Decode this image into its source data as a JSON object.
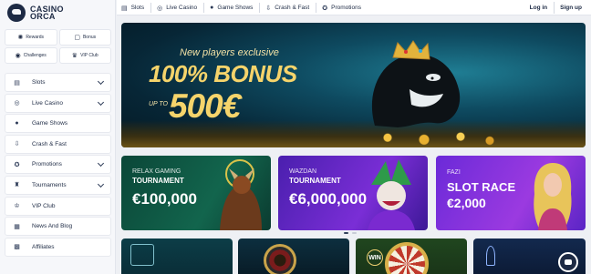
{
  "logo": {
    "line1": "CASINO",
    "line2": "ORCA"
  },
  "quick_links": [
    {
      "label": "Rewards",
      "icon": "rewards-icon",
      "glyph": "✺"
    },
    {
      "label": "Bonus",
      "icon": "bonus-icon",
      "glyph": "▢"
    },
    {
      "label": "Challenges",
      "icon": "challenges-icon",
      "glyph": "◉"
    },
    {
      "label": "VIP Club",
      "icon": "vip-club-icon",
      "glyph": "♛"
    }
  ],
  "sidebar": {
    "items": [
      {
        "label": "Slots",
        "icon": "slots-icon",
        "glyph": "▤",
        "expandable": true
      },
      {
        "label": "Live Casino",
        "icon": "live-casino-icon",
        "glyph": "◎",
        "expandable": true
      },
      {
        "label": "Game Shows",
        "icon": "game-shows-icon",
        "glyph": "●",
        "expandable": false
      },
      {
        "label": "Crash & Fast",
        "icon": "crash-fast-icon",
        "glyph": "⇩",
        "expandable": false
      },
      {
        "label": "Promotions",
        "icon": "promotions-icon",
        "glyph": "✪",
        "expandable": true
      },
      {
        "label": "Tournaments",
        "icon": "tournaments-icon",
        "glyph": "♜",
        "expandable": true
      },
      {
        "label": "VIP Club",
        "icon": "vip-club-icon",
        "glyph": "♔",
        "expandable": false
      },
      {
        "label": "News And Blog",
        "icon": "news-blog-icon",
        "glyph": "▦",
        "expandable": false
      },
      {
        "label": "Affiliates",
        "icon": "affiliates-icon",
        "glyph": "▩",
        "expandable": false
      }
    ]
  },
  "topnav": {
    "items": [
      {
        "label": "Slots",
        "glyph": "▤",
        "icon": "slots-icon"
      },
      {
        "label": "Live Casino",
        "glyph": "◎",
        "icon": "live-casino-icon"
      },
      {
        "label": "Game Shows",
        "glyph": "●",
        "icon": "game-shows-icon"
      },
      {
        "label": "Crash & Fast",
        "glyph": "⇩",
        "icon": "crash-fast-icon"
      },
      {
        "label": "Promotions",
        "glyph": "✪",
        "icon": "promotions-icon"
      }
    ],
    "login": "Log in",
    "signup": "Sign up"
  },
  "hero": {
    "line1": "New players exclusive",
    "line2": "100% BONUS",
    "upto": "UP TO",
    "line3": "500€"
  },
  "promos": [
    {
      "small": "RELAX GAMING",
      "title": "TOURNAMENT",
      "amount": "€100,000"
    },
    {
      "small": "WAZDAN",
      "title": "TOURNAMENT",
      "amount": "€6,000,000"
    },
    {
      "small": "FAZI",
      "title": "SLOT RACE",
      "amount": "€2,000"
    }
  ],
  "tiles": {
    "win_label": "WIN"
  },
  "carousel": {
    "slides": 2,
    "active": 1
  }
}
